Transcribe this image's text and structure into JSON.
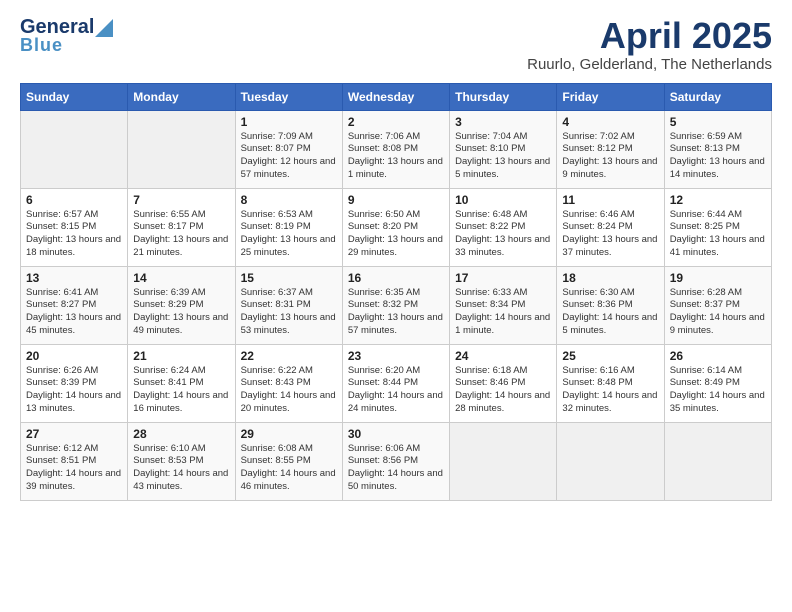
{
  "logo": {
    "line1": "General",
    "line2": "Blue"
  },
  "title": "April 2025",
  "subtitle": "Ruurlo, Gelderland, The Netherlands",
  "days_of_week": [
    "Sunday",
    "Monday",
    "Tuesday",
    "Wednesday",
    "Thursday",
    "Friday",
    "Saturday"
  ],
  "weeks": [
    [
      {
        "num": "",
        "detail": ""
      },
      {
        "num": "",
        "detail": ""
      },
      {
        "num": "1",
        "detail": "Sunrise: 7:09 AM\nSunset: 8:07 PM\nDaylight: 12 hours and 57 minutes."
      },
      {
        "num": "2",
        "detail": "Sunrise: 7:06 AM\nSunset: 8:08 PM\nDaylight: 13 hours and 1 minute."
      },
      {
        "num": "3",
        "detail": "Sunrise: 7:04 AM\nSunset: 8:10 PM\nDaylight: 13 hours and 5 minutes."
      },
      {
        "num": "4",
        "detail": "Sunrise: 7:02 AM\nSunset: 8:12 PM\nDaylight: 13 hours and 9 minutes."
      },
      {
        "num": "5",
        "detail": "Sunrise: 6:59 AM\nSunset: 8:13 PM\nDaylight: 13 hours and 14 minutes."
      }
    ],
    [
      {
        "num": "6",
        "detail": "Sunrise: 6:57 AM\nSunset: 8:15 PM\nDaylight: 13 hours and 18 minutes."
      },
      {
        "num": "7",
        "detail": "Sunrise: 6:55 AM\nSunset: 8:17 PM\nDaylight: 13 hours and 21 minutes."
      },
      {
        "num": "8",
        "detail": "Sunrise: 6:53 AM\nSunset: 8:19 PM\nDaylight: 13 hours and 25 minutes."
      },
      {
        "num": "9",
        "detail": "Sunrise: 6:50 AM\nSunset: 8:20 PM\nDaylight: 13 hours and 29 minutes."
      },
      {
        "num": "10",
        "detail": "Sunrise: 6:48 AM\nSunset: 8:22 PM\nDaylight: 13 hours and 33 minutes."
      },
      {
        "num": "11",
        "detail": "Sunrise: 6:46 AM\nSunset: 8:24 PM\nDaylight: 13 hours and 37 minutes."
      },
      {
        "num": "12",
        "detail": "Sunrise: 6:44 AM\nSunset: 8:25 PM\nDaylight: 13 hours and 41 minutes."
      }
    ],
    [
      {
        "num": "13",
        "detail": "Sunrise: 6:41 AM\nSunset: 8:27 PM\nDaylight: 13 hours and 45 minutes."
      },
      {
        "num": "14",
        "detail": "Sunrise: 6:39 AM\nSunset: 8:29 PM\nDaylight: 13 hours and 49 minutes."
      },
      {
        "num": "15",
        "detail": "Sunrise: 6:37 AM\nSunset: 8:31 PM\nDaylight: 13 hours and 53 minutes."
      },
      {
        "num": "16",
        "detail": "Sunrise: 6:35 AM\nSunset: 8:32 PM\nDaylight: 13 hours and 57 minutes."
      },
      {
        "num": "17",
        "detail": "Sunrise: 6:33 AM\nSunset: 8:34 PM\nDaylight: 14 hours and 1 minute."
      },
      {
        "num": "18",
        "detail": "Sunrise: 6:30 AM\nSunset: 8:36 PM\nDaylight: 14 hours and 5 minutes."
      },
      {
        "num": "19",
        "detail": "Sunrise: 6:28 AM\nSunset: 8:37 PM\nDaylight: 14 hours and 9 minutes."
      }
    ],
    [
      {
        "num": "20",
        "detail": "Sunrise: 6:26 AM\nSunset: 8:39 PM\nDaylight: 14 hours and 13 minutes."
      },
      {
        "num": "21",
        "detail": "Sunrise: 6:24 AM\nSunset: 8:41 PM\nDaylight: 14 hours and 16 minutes."
      },
      {
        "num": "22",
        "detail": "Sunrise: 6:22 AM\nSunset: 8:43 PM\nDaylight: 14 hours and 20 minutes."
      },
      {
        "num": "23",
        "detail": "Sunrise: 6:20 AM\nSunset: 8:44 PM\nDaylight: 14 hours and 24 minutes."
      },
      {
        "num": "24",
        "detail": "Sunrise: 6:18 AM\nSunset: 8:46 PM\nDaylight: 14 hours and 28 minutes."
      },
      {
        "num": "25",
        "detail": "Sunrise: 6:16 AM\nSunset: 8:48 PM\nDaylight: 14 hours and 32 minutes."
      },
      {
        "num": "26",
        "detail": "Sunrise: 6:14 AM\nSunset: 8:49 PM\nDaylight: 14 hours and 35 minutes."
      }
    ],
    [
      {
        "num": "27",
        "detail": "Sunrise: 6:12 AM\nSunset: 8:51 PM\nDaylight: 14 hours and 39 minutes."
      },
      {
        "num": "28",
        "detail": "Sunrise: 6:10 AM\nSunset: 8:53 PM\nDaylight: 14 hours and 43 minutes."
      },
      {
        "num": "29",
        "detail": "Sunrise: 6:08 AM\nSunset: 8:55 PM\nDaylight: 14 hours and 46 minutes."
      },
      {
        "num": "30",
        "detail": "Sunrise: 6:06 AM\nSunset: 8:56 PM\nDaylight: 14 hours and 50 minutes."
      },
      {
        "num": "",
        "detail": ""
      },
      {
        "num": "",
        "detail": ""
      },
      {
        "num": "",
        "detail": ""
      }
    ]
  ]
}
